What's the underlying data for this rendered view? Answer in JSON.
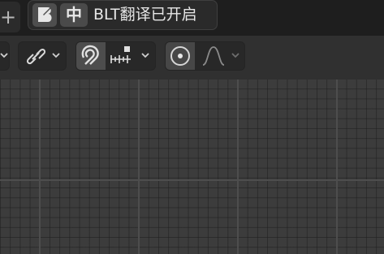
{
  "tabs": {
    "add_label": "+"
  },
  "translator": {
    "logo_letter": "B",
    "mode_label": "中",
    "status_text": "BLT翻译已开启"
  },
  "header": {
    "link_icon": "link-icon",
    "snap_icon": "magnet-icon",
    "snap_target_icon": "snap-increment-icon",
    "proportional_icon": "proportional-editing-icon",
    "falloff_icon": "falloff-curve-icon",
    "dropdown_icon": "chevron-down-icon",
    "snap_enabled": true,
    "proportional_enabled": true
  },
  "colors": {
    "topbar": "#1e1e1e",
    "header": "#303030",
    "viewport": "#3c3c3c"
  }
}
